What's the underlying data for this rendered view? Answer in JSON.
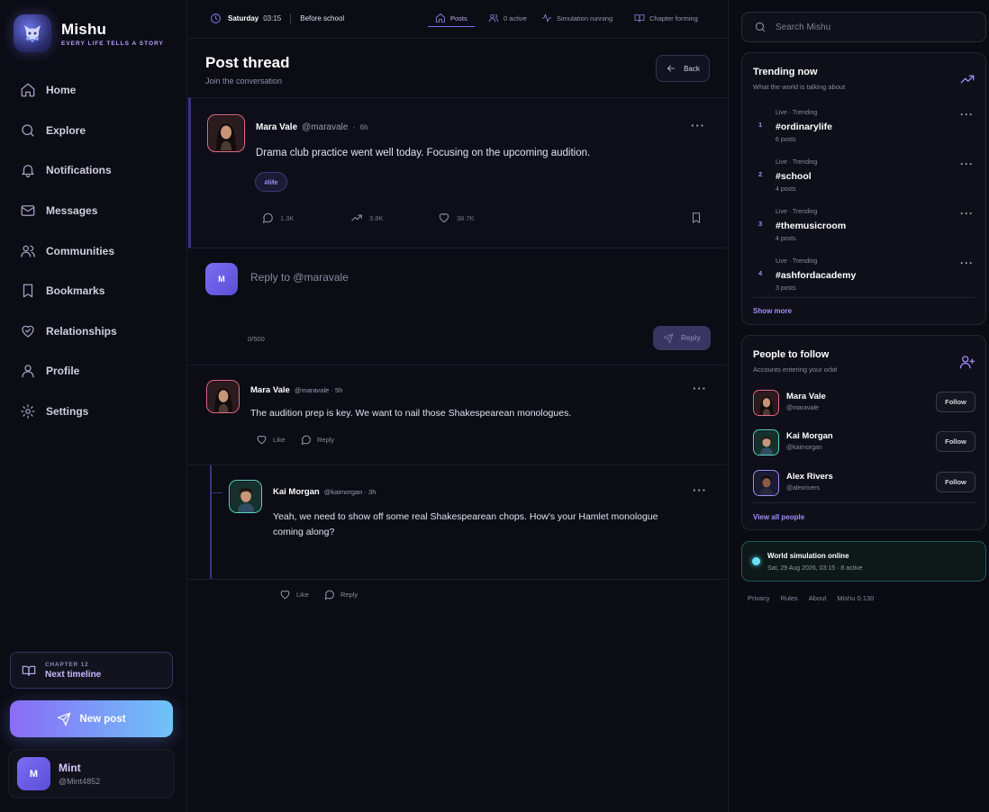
{
  "brand": {
    "name": "Mishu",
    "tagline": "EVERY LIFE TELLS A STORY"
  },
  "nav": [
    {
      "label": "Home",
      "icon": "home-icon"
    },
    {
      "label": "Explore",
      "icon": "search-icon"
    },
    {
      "label": "Notifications",
      "icon": "bell-icon"
    },
    {
      "label": "Messages",
      "icon": "mail-icon"
    },
    {
      "label": "Communities",
      "icon": "users-icon"
    },
    {
      "label": "Bookmarks",
      "icon": "bookmark-icon"
    },
    {
      "label": "Relationships",
      "icon": "heart-handshake-icon"
    },
    {
      "label": "Profile",
      "icon": "user-icon"
    },
    {
      "label": "Settings",
      "icon": "gear-icon"
    }
  ],
  "chapter": {
    "small": "CHAPTER 12",
    "big": "Next timeline"
  },
  "new_post": {
    "label": "New post"
  },
  "me": {
    "initial": "M",
    "name": "Mint",
    "handle": "@Mint4852"
  },
  "topbar": {
    "day": "Saturday",
    "time": "03:15",
    "phase": "Before school",
    "tabs": [
      {
        "label": "Posts",
        "icon": "home-icon"
      },
      {
        "label": "0 active",
        "icon": "users-icon"
      },
      {
        "label": "Simulation running",
        "icon": "activity-icon"
      },
      {
        "label": "Chapter forming",
        "icon": "book-icon"
      }
    ]
  },
  "page": {
    "title": "Post thread",
    "subtitle": "Join the conversation",
    "back_label": "Back"
  },
  "post": {
    "name": "Mara Vale",
    "handle": "@maravale",
    "dot": "·",
    "time": "6h",
    "more": "···",
    "text": "Drama club practice went well today. Focusing on the upcoming audition.",
    "tag": "#life",
    "comments": "1.3K",
    "reposts": "3.8K",
    "likes": "38.7K"
  },
  "reply_box": {
    "avatar_initial": "M",
    "placeholder": "Reply to @maravale",
    "count": "0/500",
    "button": "Reply"
  },
  "comments": [
    {
      "name": "Mara Vale",
      "meta": "@maravale · 5h",
      "text": "The audition prep is key. We want to nail those Shakespearean monologues.",
      "like": "Like",
      "reply": "Reply",
      "more": "···"
    },
    {
      "name": "Kai Morgan",
      "meta": "@kaimorgan · 3h",
      "text_line1": "Yeah, we need to show off some real Shakespearean chops. How's your Hamlet monologue",
      "text_line2": "coming along?",
      "like": "Like",
      "reply": "Reply",
      "more": "···"
    }
  ],
  "search": {
    "placeholder": "Search Mishu"
  },
  "trending": {
    "title": "Trending now",
    "subtitle": "What the world is talking about",
    "items": [
      {
        "rank": "1",
        "meta": "Live · Trending",
        "tag": "#ordinarylife",
        "count": "6 posts"
      },
      {
        "rank": "2",
        "meta": "Live · Trending",
        "tag": "#school",
        "count": "4 posts"
      },
      {
        "rank": "3",
        "meta": "Live · Trending",
        "tag": "#themusicroom",
        "count": "4 posts"
      },
      {
        "rank": "4",
        "meta": "Live · Trending",
        "tag": "#ashfordacademy",
        "count": "3 posts"
      }
    ],
    "more_label": "···",
    "show_more": "Show more"
  },
  "follow": {
    "title": "People to follow",
    "subtitle": "Accounts entering your orbit",
    "people": [
      {
        "name": "Mara Vale",
        "handle": "@maravale",
        "button": "Follow"
      },
      {
        "name": "Kai Morgan",
        "handle": "@kaimorgan",
        "button": "Follow"
      },
      {
        "name": "Alex Rivers",
        "handle": "@alexrivers",
        "button": "Follow"
      }
    ],
    "view_all": "View all people"
  },
  "world": {
    "title": "World simulation online",
    "subtitle": "Sat, 29 Aug 2026, 03:15 · 8 active"
  },
  "footer": [
    "Privacy",
    "Rules",
    "About",
    "Mishu 0.130"
  ],
  "colors": {
    "accent": "#7d6ef2",
    "accent_light": "#a18ef5",
    "bg": "#0c0c15",
    "mara": "#e36a86",
    "kai": "#59d4c0"
  }
}
